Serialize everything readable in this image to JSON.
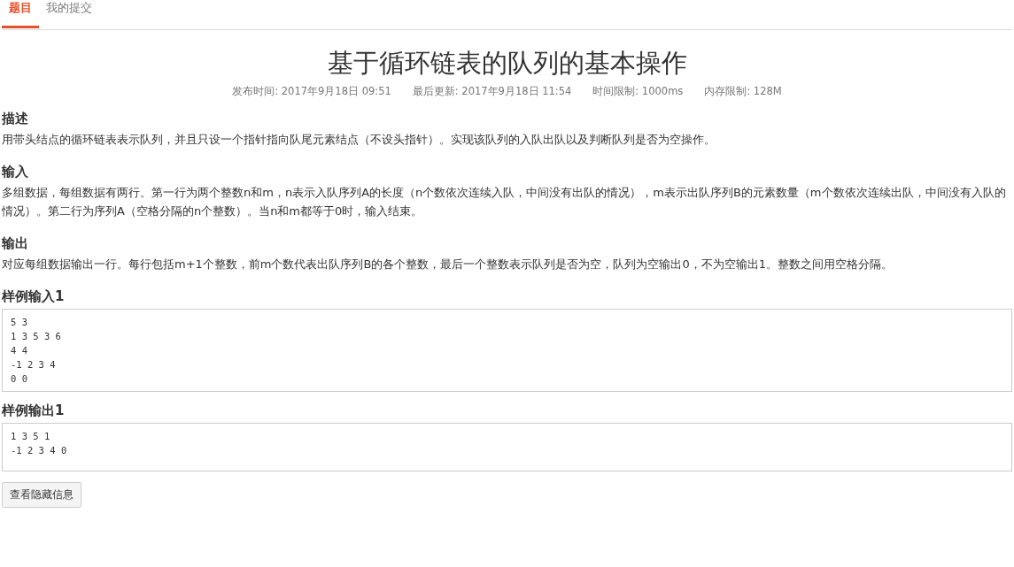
{
  "tabs": [
    {
      "label": "题目",
      "selected": true
    },
    {
      "label": "我的提交",
      "selected": false
    }
  ],
  "problem": {
    "title": "基于循环链表的队列的基本操作",
    "meta": [
      "发布时间: 2017年9月18日 09:51",
      "最后更新: 2017年9月18日 11:54",
      "时间限制: 1000ms",
      "内存限制: 128M"
    ],
    "sections": [
      {
        "heading": "描述",
        "text": "用带头结点的循环链表表示队列，并且只设一个指针指向队尾元素结点（不设头指针）。实现该队列的入队出队以及判断队列是否为空操作。"
      },
      {
        "heading": "输入",
        "text": "多组数据，每组数据有两行。第一行为两个整数n和m，n表示入队序列A的长度（n个数依次连续入队，中间没有出队的情况），m表示出队序列B的元素数量（m个数依次连续出队，中间没有入队的情况）。第二行为序列A（空格分隔的n个整数）。当n和m都等于0时，输入结束。"
      },
      {
        "heading": "输出",
        "text": "对应每组数据输出一行。每行包括m+1个整数，前m个数代表出队序列B的各个整数，最后一个整数表示队列是否为空，队列为空输出0，不为空输出1。整数之间用空格分隔。"
      }
    ],
    "samples": [
      {
        "heading": "样例输入1",
        "text": "5 3\n1 3 5 3 6\n4 4\n-1 2 3 4\n0 0"
      },
      {
        "heading": "样例输出1",
        "text": "1 3 5 1\n-1 2 3 4 0"
      }
    ],
    "button": "查看隐藏信息"
  }
}
